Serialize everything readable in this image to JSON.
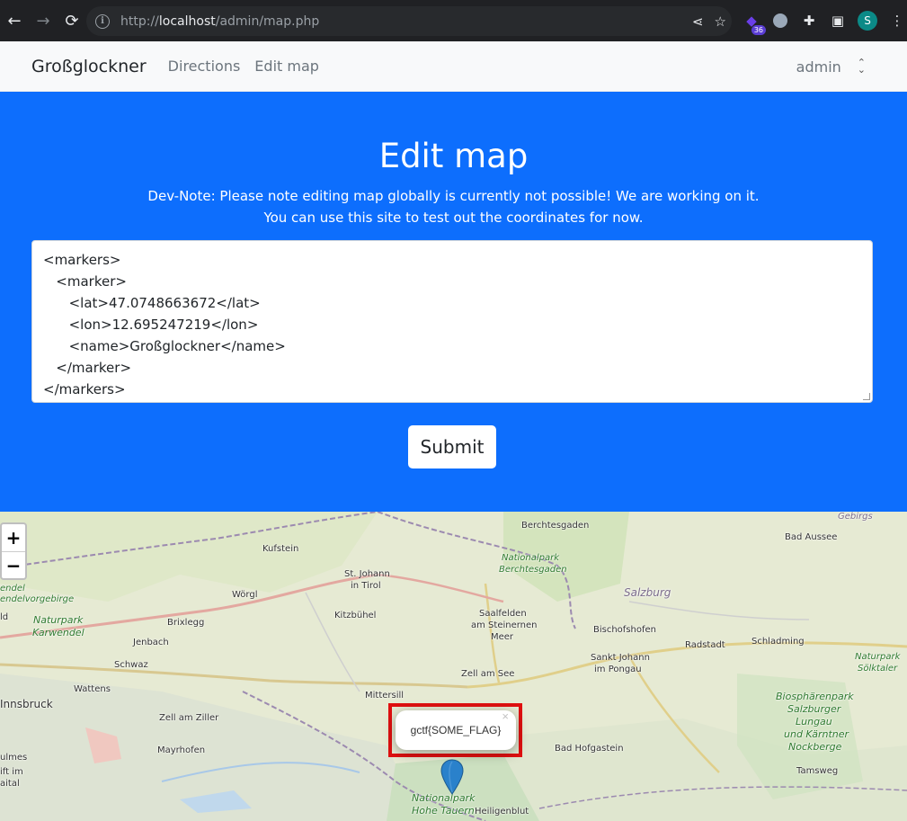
{
  "browser": {
    "url_scheme_host_prefix": "http://",
    "url_host": "localhost",
    "url_path": "/admin/map.php",
    "extension_badge": "36",
    "profile_initial": "S"
  },
  "navbar": {
    "brand": "Großglockner",
    "links": [
      "Directions",
      "Edit map"
    ],
    "user": "admin"
  },
  "hero": {
    "title": "Edit map",
    "note_line1": "Dev-Note: Please note editing map globally is currently not possible! We are working on it.",
    "note_line2": "You can use this site to test out the coordinates for now.",
    "xml_lines": [
      "<markers>",
      "   <marker>",
      "      <lat>47.0748663672</lat>",
      "      <lon>12.695247219</lon>",
      "      <name>Großglockner</name>",
      "   </marker>",
      "</markers>"
    ],
    "submit_label": "Submit"
  },
  "map": {
    "zoom_in": "+",
    "zoom_out": "−",
    "popup_text": "gctf{SOME_FLAG}",
    "popup_close": "×",
    "labels": {
      "berchtesgaden": "Berchtesgaden",
      "gebirgs": "Gebirgs",
      "bad_aussee": "Bad Aussee",
      "kufstein": "Kufstein",
      "np_berchtesgaden_1": "Nationalpark",
      "np_berchtesgaden_2": "Berchtesgaden",
      "st_johann_1": "St. Johann",
      "st_johann_2": "in Tirol",
      "salzburg": "Salzburg",
      "wendel": "endel",
      "wendelvorgebirge": "endelvorgebirge",
      "woergl": "Wörgl",
      "kitzbuehel": "Kitzbühel",
      "saalfelden_1": "Saalfelden",
      "saalfelden_2": "am Steinernen",
      "saalfelden_3": "Meer",
      "bischofshofen": "Bischofshofen",
      "np_karwendel_1": "Naturpark",
      "np_karwendel_2": "Karwendel",
      "brixlegg": "Brixlegg",
      "ld": "ld",
      "jenbach": "Jenbach",
      "radstadt": "Radstadt",
      "schladming": "Schladming",
      "np_soelktaler_1": "Naturpark",
      "np_soelktaler_2": "Sölktaler",
      "schwaz": "Schwaz",
      "sankt_johann_1": "Sankt Johann",
      "sankt_johann_2": "im Pongau",
      "zell_am_see": "Zell am See",
      "wattens": "Wattens",
      "mittersill": "Mittersill",
      "innsbruck": "Innsbruck",
      "bio_1": "Biosphärenpark",
      "bio_2": "Salzburger",
      "bio_3": "Lungau",
      "bio_4": "und Kärntner",
      "bio_5": "Nockberge",
      "zell_am_ziller": "Zell am Ziller",
      "mayrhofen": "Mayrhofen",
      "bad_hofgastein": "Bad Hofgastein",
      "ulmes": "ulmes",
      "ift_im": "ift im",
      "aital": "aital",
      "tamsweg": "Tamsweg",
      "np_hohe_tauern_1": "Nationalpark",
      "np_hohe_tauern_2": "Hohe Tauern",
      "heiligenblut": "Heiligenblut"
    }
  }
}
